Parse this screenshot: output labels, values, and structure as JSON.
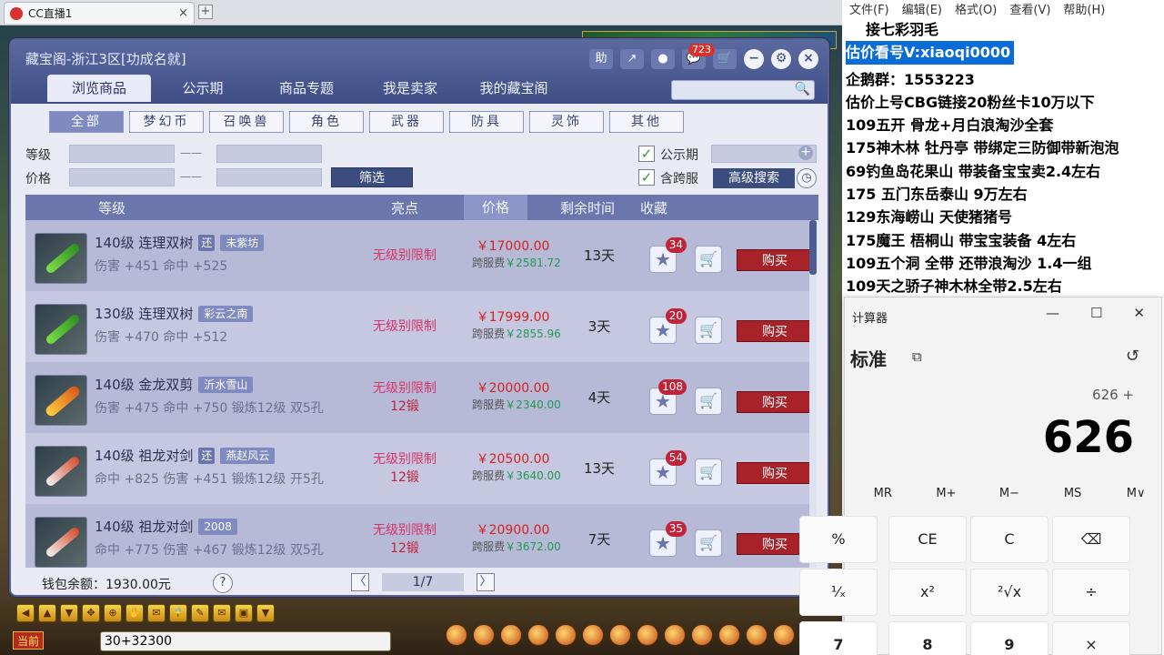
{
  "browser": {
    "tab_title": "CC直播1",
    "tab_close": "×",
    "new_tab": "+"
  },
  "game": {
    "current_btn": "当前",
    "chat_value": "30+32300",
    "bottom_icons": [
      "◀",
      "▲",
      "▼",
      "✥",
      "⊕",
      "✋",
      "✉",
      "🔒",
      "✎",
      "✉",
      "▣",
      "▼"
    ]
  },
  "dialog": {
    "title": "藏宝阁-浙江3区[功成名就]",
    "header_icons": {
      "help": "助",
      "share": "↗",
      "record": "●",
      "messages": "💬",
      "message_count": "723",
      "cart": "🛒",
      "minimize": "−",
      "settings": "⚙",
      "close": "×"
    },
    "tabs": [
      {
        "label": "浏览商品",
        "active": true
      },
      {
        "label": "公示期"
      },
      {
        "label": "商品专题"
      },
      {
        "label": "我是卖家"
      },
      {
        "label": "我的藏宝阁"
      }
    ],
    "search_icon": "🔍",
    "categories": [
      {
        "label": "全部",
        "active": true
      },
      {
        "label": "梦幻币"
      },
      {
        "label": "召唤兽"
      },
      {
        "label": "角色"
      },
      {
        "label": "武器"
      },
      {
        "label": "防具"
      },
      {
        "label": "灵饰"
      },
      {
        "label": "其他"
      }
    ],
    "filters": {
      "level_label": "等级",
      "price_label": "价格",
      "dash": "——",
      "filter_btn": "筛选",
      "public_label": "公示期",
      "cross_label": "含跨服",
      "check": "✓",
      "advanced_btn": "高级搜索",
      "clock": "◷",
      "plus": "+"
    },
    "table_head": {
      "level": "等级",
      "highlight": "亮点",
      "price": "价格",
      "remaining": "剩余时间",
      "favorite": "收藏"
    },
    "rows": [
      {
        "name": "140级 连理双树",
        "tag1": "还",
        "tag2": "未紫坊",
        "stats": "伤害 +451 命中 +525",
        "highlight": "无级别限制",
        "forge": "",
        "price": "￥17000.00",
        "xfee_label": "跨服费",
        "xfee": "￥2581.72",
        "days": "13天",
        "fav": "34",
        "icon": "green"
      },
      {
        "name": "130级 连理双树",
        "tag1": "",
        "tag2": "彩云之南",
        "stats": "伤害 +470 命中 +512",
        "highlight": "无级别限制",
        "forge": "",
        "price": "￥17999.00",
        "xfee_label": "跨服费",
        "xfee": "￥2855.96",
        "days": "3天",
        "fav": "20",
        "icon": "green"
      },
      {
        "name": "140级 金龙双剪",
        "tag1": "",
        "tag2": "沂水雪山",
        "stats": "伤害 +475 命中 +750 锻炼12级 双5孔",
        "highlight": "无级别限制",
        "forge": "12锻",
        "price": "￥20000.00",
        "xfee_label": "跨服费",
        "xfee": "￥2340.00",
        "days": "4天",
        "fav": "108",
        "icon": "gold"
      },
      {
        "name": "140级 祖龙对剑",
        "tag1": "还",
        "tag2": "燕赵风云",
        "stats": "命中 +825 伤害 +451 锻炼12级 开5孔",
        "highlight": "无级别限制",
        "forge": "12锻",
        "price": "￥20500.00",
        "xfee_label": "跨服费",
        "xfee": "￥3640.00",
        "days": "13天",
        "fav": "54",
        "icon": "red"
      },
      {
        "name": "140级 祖龙对剑",
        "tag1": "",
        "tag2": "2008",
        "stats": "命中 +775 伤害 +467 锻炼12级 双5孔",
        "highlight": "无级别限制",
        "forge": "12锻",
        "price": "￥20900.00",
        "xfee_label": "跨服费",
        "xfee": "￥3672.00",
        "days": "7天",
        "fav": "35",
        "icon": "red"
      }
    ],
    "star": "★",
    "cart": "🛒",
    "buy_label": "购买",
    "footer": {
      "wallet": "钱包余额：1930.00元",
      "help": "?",
      "prev": "〈",
      "page": "1/7",
      "next": "〉"
    }
  },
  "notepad": {
    "menu": [
      "文件(F)",
      "编辑(E)",
      "格式(O)",
      "查看(V)",
      "帮助(H)"
    ],
    "lines": [
      "接七彩羽毛",
      "估价看号V:xiaoqi0000",
      "企鹅群：1553223",
      "估价上号CBG链接20粉丝卡10万以下",
      "109五开 骨龙+月白浪淘沙全套",
      "175神木林 牡丹亭 带绑定三防御带新泡泡",
      "69钓鱼岛花果山 带装备宝宝卖2.4左右",
      "175 五门东岳泰山 9万左右",
      "129东海崂山 天使猪猪号",
      "175魔王 梧桐山 带宝宝装备 4左右",
      "109五个洞 全带 还带浪淘沙 1.4一组",
      "109天之骄子神木林全带2.5左右"
    ]
  },
  "calculator": {
    "title": "计算器",
    "minimize": "—",
    "maximize": "☐",
    "close": "✕",
    "mode": "标准",
    "mode_icon": "⧉",
    "history_icon": "↺",
    "expression": "626 +",
    "display": "626",
    "memory": [
      "MR",
      "M+",
      "M−",
      "MS",
      "M∨"
    ],
    "keys_row1": [
      "%",
      "CE",
      "C",
      "⌫"
    ],
    "keys_row2": [
      "¹⁄ₓ",
      "x²",
      "²√x",
      "÷"
    ],
    "keys_row3": [
      "7",
      "8",
      "9",
      "×"
    ]
  }
}
